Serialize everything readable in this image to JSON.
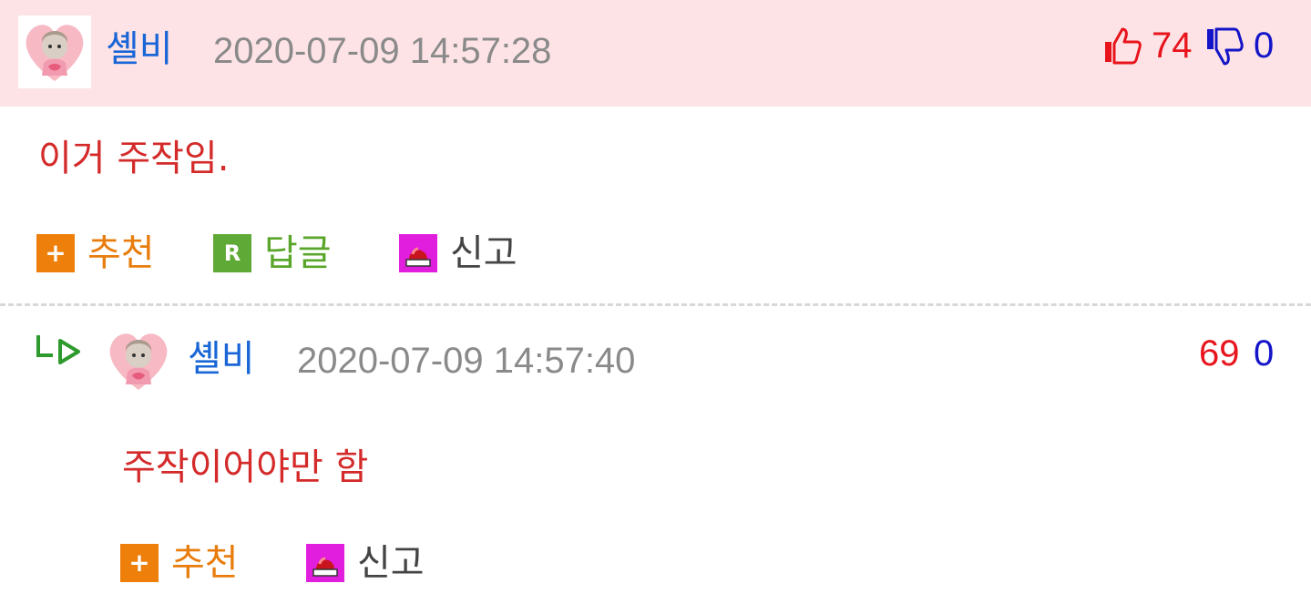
{
  "comment": {
    "author": "셸비",
    "timestamp": "2020-07-09 14:57:28",
    "upvotes": "74",
    "downvotes": "0",
    "text": "이거 주작임.",
    "actions": {
      "recommend": "추천",
      "reply": "답글",
      "report": "신고"
    },
    "badges": {
      "recommend": "+",
      "reply": "R"
    }
  },
  "reply": {
    "author": "셸비",
    "timestamp": "2020-07-09 14:57:40",
    "upvotes": "69",
    "downvotes": "0",
    "text": "주작이어야만 함",
    "actions": {
      "recommend": "추천",
      "report": "신고"
    },
    "badges": {
      "recommend": "+"
    }
  },
  "colors": {
    "header_bg": "#fde3e6",
    "nickname": "#1a66d6",
    "timestamp": "#8a8a8a",
    "upvote": "#e8141c",
    "downvote": "#1414c8",
    "comment_text": "#d42a2a",
    "recommend": "#ee7f0a",
    "reply": "#5fa936",
    "report": "#e21ede"
  },
  "icons": {
    "thumbs_up": "thumbs-up-icon",
    "thumbs_down": "thumbs-down-icon",
    "reply_arrow": "reply-arrow-icon",
    "report": "siren-icon"
  }
}
